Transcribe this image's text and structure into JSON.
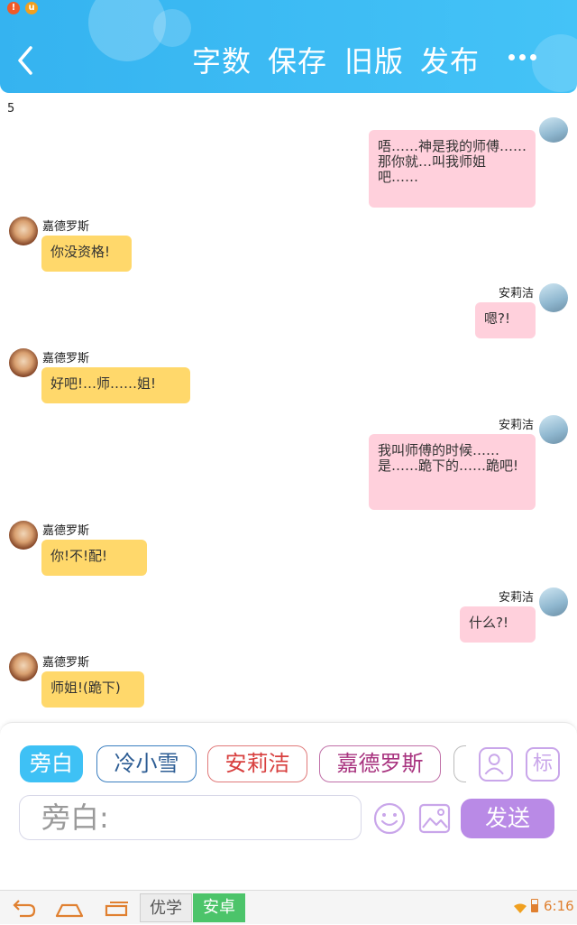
{
  "header": {
    "back_icon": "chevron-left-icon",
    "buttons": [
      "字数",
      "保存",
      "旧版",
      "发布"
    ],
    "more_icon": "more-dots-icon",
    "color": "#3db8f3"
  },
  "status_dots": [
    "!",
    "u"
  ],
  "chat": {
    "counter": "5",
    "messages": [
      {
        "side": "right",
        "speaker": "",
        "text": "唔……神是我的师傅……\n那你就…叫我师姐\n吧……"
      },
      {
        "side": "left",
        "speaker": "嘉德罗斯",
        "text": "你没资格!"
      },
      {
        "side": "right",
        "speaker": "安莉洁",
        "text": "嗯?!"
      },
      {
        "side": "left",
        "speaker": "嘉德罗斯",
        "text": "好吧!…师……姐!"
      },
      {
        "side": "right",
        "speaker": "安莉洁",
        "text": "我叫师傅的时候……\n是……跪下的……跪吧!"
      },
      {
        "side": "left",
        "speaker": "嘉德罗斯",
        "text": "你!不!配!"
      },
      {
        "side": "right",
        "speaker": "安莉洁",
        "text": "什么?!"
      },
      {
        "side": "left",
        "speaker": "嘉德罗斯",
        "text": "师姐!(跪下)"
      }
    ],
    "colors": {
      "left_bubble": "#ffd86b",
      "right_bubble": "#ffd0dc"
    }
  },
  "composer": {
    "roles": [
      "旁白",
      "冷小雪",
      "安莉洁",
      "嘉德罗斯"
    ],
    "selected_role": "旁白",
    "role_colors": [
      "#3ec1f5",
      "#3b7fc0",
      "#e05a5a",
      "#b3418f"
    ],
    "role_manage_icon": "person-icon",
    "tag_icon_label": "标",
    "input_placeholder": "旁白:",
    "emoji_icon": "smiley-icon",
    "image_icon": "image-icon",
    "send_label": "发送",
    "send_color": "#b98ae6"
  },
  "navbar": {
    "back_icon": "back-arrow-icon",
    "home_icon": "home-icon",
    "recent_icon": "recent-apps-icon",
    "tabs": [
      "优学",
      "安卓"
    ],
    "time": "6:16"
  }
}
